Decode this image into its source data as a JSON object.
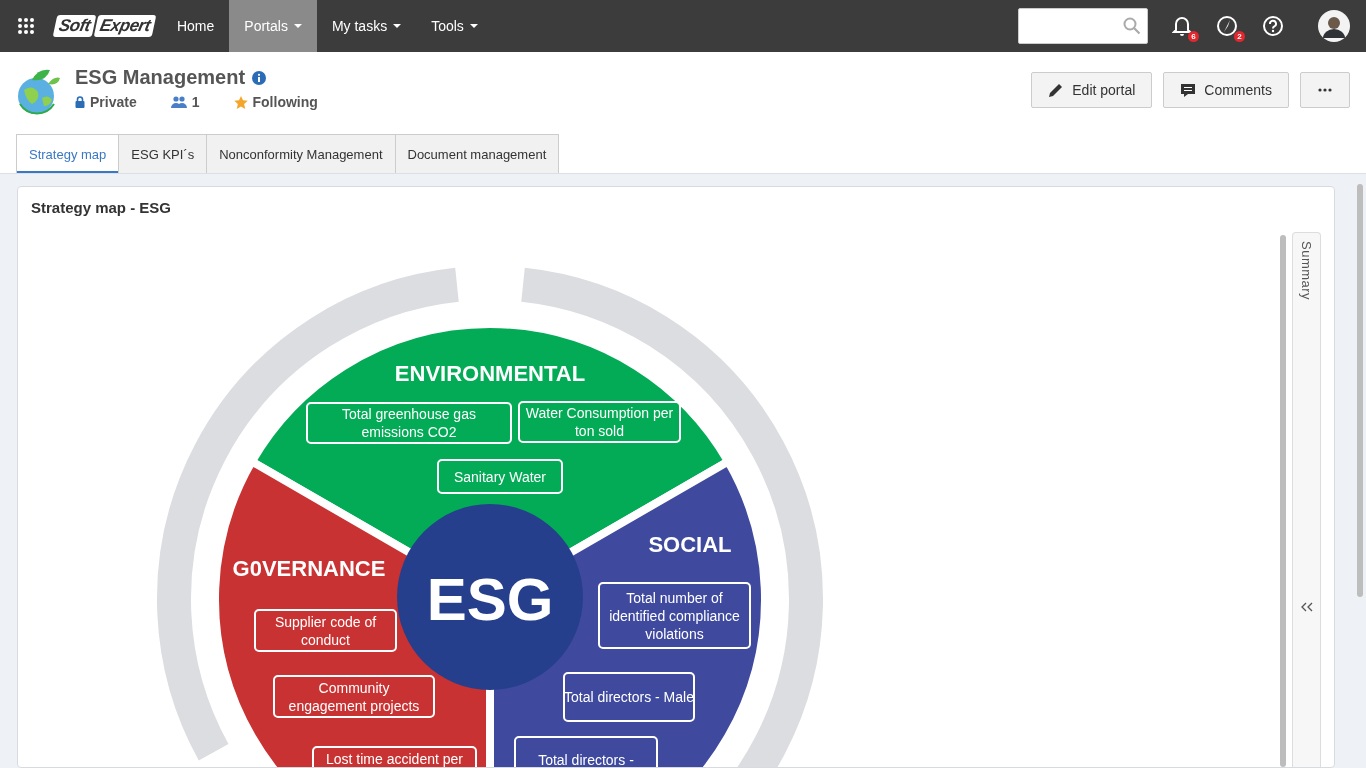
{
  "top_bar": {
    "logo": [
      "Soft",
      "Expert"
    ],
    "nav": [
      {
        "label": "Home",
        "selected": false,
        "dropdown": false
      },
      {
        "label": "Portals",
        "selected": true,
        "dropdown": true
      },
      {
        "label": "My tasks",
        "selected": false,
        "dropdown": true
      },
      {
        "label": "Tools",
        "selected": false,
        "dropdown": true
      }
    ],
    "notifications_badge": "6",
    "tasks_badge": "2"
  },
  "portal": {
    "title": "ESG Management",
    "privacy": "Private",
    "members": "1",
    "following": "Following"
  },
  "actions": [
    {
      "kind": "edit",
      "label": "Edit portal"
    },
    {
      "kind": "comments",
      "label": "Comments"
    },
    {
      "kind": "more"
    }
  ],
  "tabs": [
    {
      "label": "Strategy map",
      "selected": true
    },
    {
      "label": "ESG KPI´s",
      "selected": false
    },
    {
      "label": "Nonconformity Management",
      "selected": false
    },
    {
      "label": "Document management",
      "selected": false
    }
  ],
  "card": {
    "title": "Strategy map - ESG",
    "side_panel": "Summary"
  },
  "diagram": {
    "center": "ESG",
    "sectors": [
      {
        "title": "ENVIRONMENTAL",
        "color": "#04ab56",
        "kpis": [
          {
            "lines": [
              "Total greenhouse gas",
              "emissions CO2"
            ]
          },
          {
            "lines": [
              "Water Consumption per",
              "ton sold"
            ]
          },
          {
            "lines": [
              "Sanitary Water"
            ]
          }
        ]
      },
      {
        "title": "G0VERNANCE",
        "color": "#c93232",
        "kpis": [
          {
            "lines": [
              "Supplier code of",
              "conduct"
            ]
          },
          {
            "lines": [
              "Community",
              "engagement projects"
            ]
          },
          {
            "lines": [
              "Lost time accident per"
            ]
          }
        ]
      },
      {
        "title": "SOCIAL",
        "color": "#3f4a9e",
        "kpis": [
          {
            "lines": [
              "Total number of",
              "identified compliance",
              "violations"
            ]
          },
          {
            "lines": [
              "Total directors - Male"
            ]
          },
          {
            "lines": [
              "Total directors -"
            ]
          }
        ]
      }
    ]
  }
}
